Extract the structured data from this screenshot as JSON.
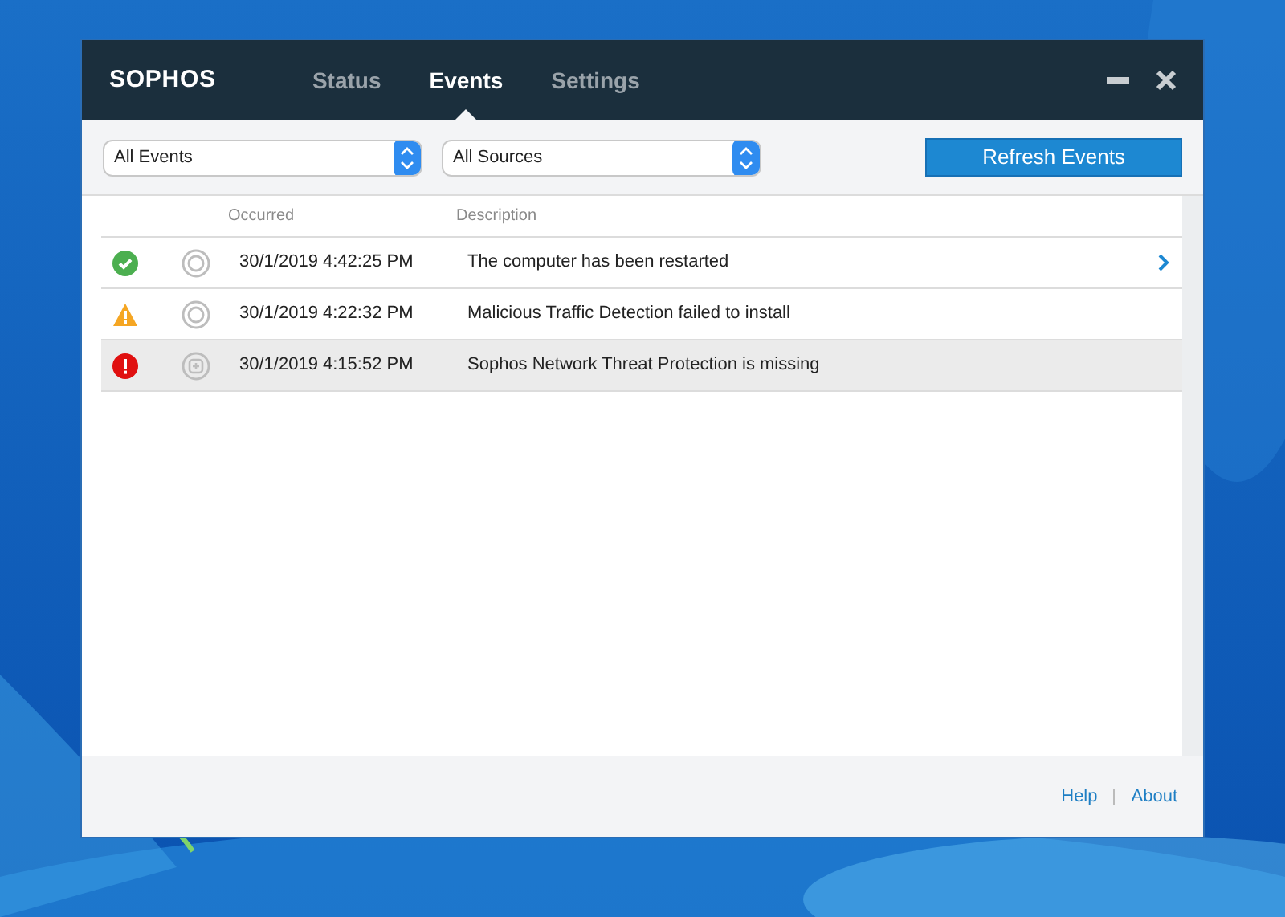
{
  "window": {
    "title": "SOPHOS"
  },
  "tabs": [
    {
      "label": "Status",
      "selected": false
    },
    {
      "label": "Events",
      "selected": true
    },
    {
      "label": "Settings",
      "selected": false
    }
  ],
  "filters": [
    {
      "value": "All Events"
    },
    {
      "value": "All Sources"
    }
  ],
  "refresh_button": {
    "label": "Refresh Events"
  },
  "table": {
    "columns": [
      "Occurred",
      "Description"
    ],
    "rows": [
      {
        "kind": "success",
        "source_icon": {
          "kind": "ring"
        },
        "occurred": "30/1/2019 4:42:25 PM",
        "description": "The computer has been restarted",
        "selected": false,
        "hovered": true
      },
      {
        "kind": "warning",
        "source_icon": {
          "kind": "ring"
        },
        "occurred": "30/1/2019 4:22:32 PM",
        "description": "Malicious Traffic Detection failed to install",
        "selected": false,
        "hovered": false
      },
      {
        "kind": "error",
        "source_icon": {
          "kind": "plus"
        },
        "occurred": "30/1/2019 4:15:52 PM",
        "description": "Sophos Network Threat Protection is missing",
        "selected": true,
        "hovered": false
      }
    ]
  },
  "footer_links": [
    "Help",
    "About"
  ]
}
